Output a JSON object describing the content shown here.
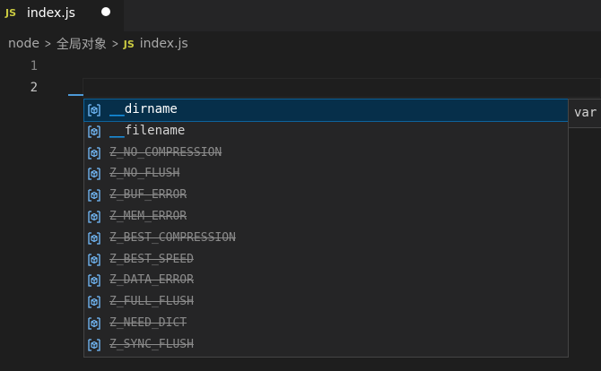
{
  "tab": {
    "badge": "JS",
    "label": "index.js",
    "dirty": true
  },
  "breadcrumb": {
    "items": [
      "node",
      "全局对象",
      "index.js"
    ],
    "separator": "chevron-right-icon",
    "file_badge": "JS"
  },
  "editor": {
    "line_numbers": [
      "1",
      "2"
    ],
    "active_line": "2",
    "typed_text": "__"
  },
  "suggest": {
    "icon": "variable-icon",
    "items": [
      {
        "match": "__",
        "rest": "dirname",
        "deprecated": false,
        "selected": true
      },
      {
        "match": "__",
        "rest": "filename",
        "deprecated": false,
        "selected": false
      },
      {
        "label": "Z_NO_COMPRESSION",
        "deprecated": true
      },
      {
        "label": "Z_NO_FLUSH",
        "deprecated": true
      },
      {
        "label": "Z_BUF_ERROR",
        "deprecated": true
      },
      {
        "label": "Z_MEM_ERROR",
        "deprecated": true
      },
      {
        "label": "Z_BEST_COMPRESSION",
        "deprecated": true
      },
      {
        "label": "Z_BEST_SPEED",
        "deprecated": true
      },
      {
        "label": "Z_DATA_ERROR",
        "deprecated": true
      },
      {
        "label": "Z_FULL_FLUSH",
        "deprecated": true
      },
      {
        "label": "Z_NEED_DICT",
        "deprecated": true
      },
      {
        "label": "Z_SYNC_FLUSH",
        "deprecated": true
      }
    ],
    "details_text": "var"
  },
  "colors": {
    "background": "#1e1e1e",
    "js_badge": "#cbcb41",
    "match_highlight": "#18a3ff",
    "selection": "#062f4a",
    "variable_icon": "#75beff"
  }
}
